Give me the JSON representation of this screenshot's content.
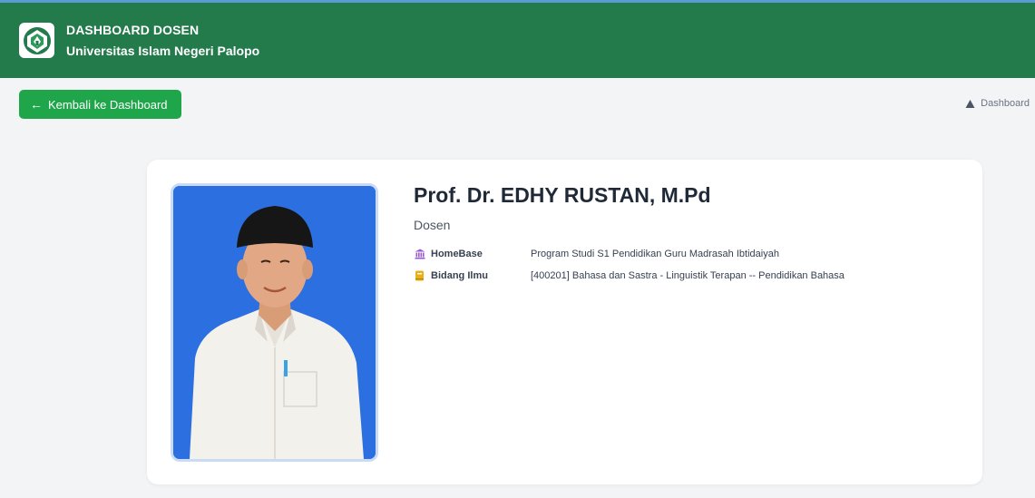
{
  "header": {
    "title": "DASHBOARD DOSEN",
    "subtitle": "Universitas Islam Negeri Palopo",
    "logo_icon": "uin-palopo-logo-icon"
  },
  "nav": {
    "back_label": "Kembali ke Dashboard",
    "breadcrumb": "Dashboard"
  },
  "profile": {
    "name": "Prof. Dr. EDHY RUSTAN, M.Pd",
    "role": "Dosen",
    "fields": [
      {
        "label": "HomeBase",
        "value": "Program Studi S1 Pendidikan Guru Madrasah Ibtidaiyah",
        "icon": "university-icon",
        "color": "#9b59d0"
      },
      {
        "label": "Bidang Ilmu",
        "value": "[400201] Bahasa dan Sastra - Linguistik Terapan -- Pendidikan Bahasa",
        "icon": "book-icon",
        "color": "#e8b01a"
      }
    ]
  },
  "colors": {
    "header_bg": "#237a4b",
    "button_bg": "#1fa64a",
    "photo_bg": "#2b6fe0"
  }
}
